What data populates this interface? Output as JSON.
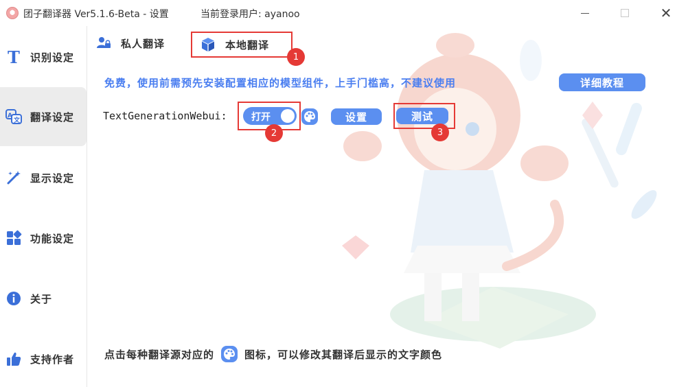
{
  "window": {
    "title": "团子翻译器 Ver5.1.6-Beta - 设置",
    "login_status": "当前登录用户: ayanoo",
    "close_glyph": "✕"
  },
  "sidebar": {
    "items": [
      {
        "label": "识别设定",
        "icon": "text-t-icon"
      },
      {
        "label": "翻译设定",
        "icon": "translate-icon",
        "active": true
      },
      {
        "label": "显示设定",
        "icon": "magic-wand-icon"
      },
      {
        "label": "功能设定",
        "icon": "grid-apps-icon"
      },
      {
        "label": "关于",
        "icon": "info-icon"
      },
      {
        "label": "支持作者",
        "icon": "thumbs-up-icon"
      }
    ]
  },
  "tabs": [
    {
      "label": "私人翻译",
      "icon": "user-lock-icon"
    },
    {
      "label": "本地翻译",
      "icon": "cube-icon",
      "active": true
    }
  ],
  "annotations": [
    "1",
    "2",
    "3"
  ],
  "content": {
    "description": "免费，使用前需预先安装配置相应的模型组件，上手门槛高，不建议使用",
    "tutorial_button": "详细教程",
    "engine_label": "TextGenerationWebui:",
    "toggle_label": "打开",
    "toggle_on": true,
    "settings_button": "设置",
    "test_button": "测试",
    "footer_prefix": "点击每种翻译源对应的",
    "footer_suffix": "图标，可以修改其翻译后显示的文字颜色"
  },
  "colors": {
    "accent": "#5b8ff0",
    "highlight": "#e53935",
    "description_text": "#4a7ef0"
  }
}
